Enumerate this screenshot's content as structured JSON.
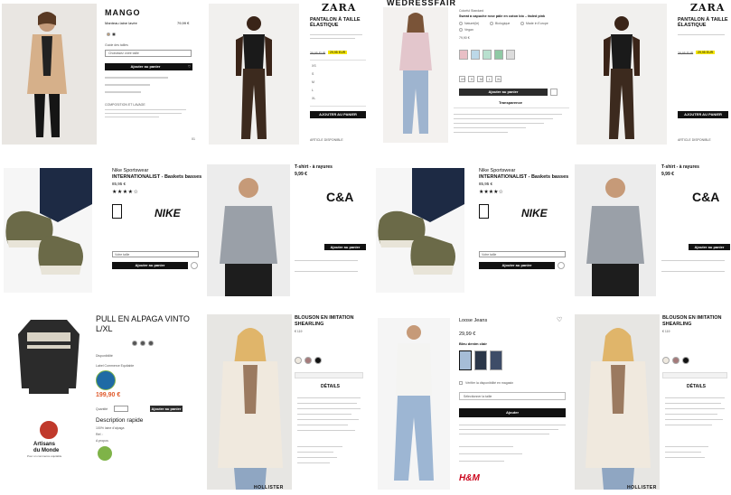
{
  "mango": {
    "brand": "MANGO",
    "product_name": "Manteau laine lavée",
    "price": "79,99 €",
    "size_label": "Guide des tailles",
    "select_placeholder": "Choisissez votre taille",
    "add_button": "Ajouter au panier",
    "composition": "COMPOSITION ET LAVAGE",
    "count": "01"
  },
  "zara1": {
    "logo": "ZARA",
    "title": "PANTALON À TAILLE ÉLASTIQUE",
    "price_old": "39,95 EUR",
    "price_new": "29,95 EUR",
    "sizes": [
      "XS",
      "S",
      "M",
      "L",
      "XL"
    ],
    "add_button": "AJOUTER AU PANIER",
    "footer_link": "ARTICLE DISPONIBLE"
  },
  "wedressfair": {
    "logo": "WEDRESSFAIR",
    "title": "Sweat à capuche rose pâle en coton bio – faded pink",
    "labels": [
      "Naturel(le)",
      "Biologique",
      "Made in Europe",
      "Vegan"
    ],
    "sizes": [
      "XS",
      "S",
      "M",
      "L",
      "XL"
    ],
    "add_button": "Ajouter au panier",
    "section": "Transparence"
  },
  "zara2": {
    "logo": "ZARA",
    "title": "PANTALON À TAILLE ÉLASTIQUE",
    "price_old": "39,95 EUR",
    "price_new": "29,95 EUR",
    "add_button": "AJOUTER AU PANIER",
    "footer_link": "ARTICLE DISPONIBLE"
  },
  "nike1": {
    "brand": "Nike Sportswear",
    "title": "INTERNATIONALIST - Baskets basses",
    "price": "85,95 €",
    "logo": "NIKE",
    "select": "Votre taille",
    "add_button": "Ajouter au panier"
  },
  "ca1": {
    "title": "T-shirt - à rayures",
    "price": "9,99 €",
    "logo": "C&A",
    "add_button": "Ajouter au panier"
  },
  "nike2": {
    "brand": "Nike Sportswear",
    "title": "INTERNATIONALIST - Baskets basses",
    "price": "85,95 €",
    "logo": "NIKE",
    "select": "Votre taille",
    "add_button": "Ajouter au panier"
  },
  "ca2": {
    "title": "T-shirt - à rayures",
    "price": "9,99 €",
    "logo": "C&A",
    "add_button": "Ajouter au panier"
  },
  "artisans": {
    "title": "PULL EN ALPAGA VINTO L/XL",
    "availability": "Disponibilité",
    "label": "Label Commerce Equitable",
    "price": "199,90 €",
    "qty_label": "Quantité",
    "add_button": "Ajouter au panier",
    "desc_title": "Description rapide",
    "desc_text": "100% laine d'alpaga",
    "ref": "Réf. :",
    "about": "A propos",
    "logo_line1": "Artisans",
    "logo_line2": "du Monde",
    "logo_tag": "Pour un commerce équitable"
  },
  "hollister1": {
    "title_line1": "BLOUSON EN IMITATION",
    "title_line2": "SHEARLING",
    "price": "€ 119",
    "details": "DÉTAILS",
    "brand": "HOLLISTER"
  },
  "hm": {
    "title": "Loose Jeans",
    "price": "29,99 €",
    "color_label": "Bleu denim clair",
    "check_label": "Vérifier la disponibilité en magasin",
    "select": "Sélectionner la taille",
    "add_button": "Ajouter",
    "logo": "H&M"
  },
  "hollister2": {
    "title_line1": "BLOUSON EN IMITATION",
    "title_line2": "SHEARLING",
    "price": "€ 119",
    "details": "DÉTAILS",
    "brand": "HOLLISTER"
  },
  "colors": {
    "accent_yellow": "#f5e600",
    "nike_black": "#111111",
    "hm_red": "#cc071e",
    "artisans_red": "#c0392b",
    "price_red": "#e05a2b"
  }
}
